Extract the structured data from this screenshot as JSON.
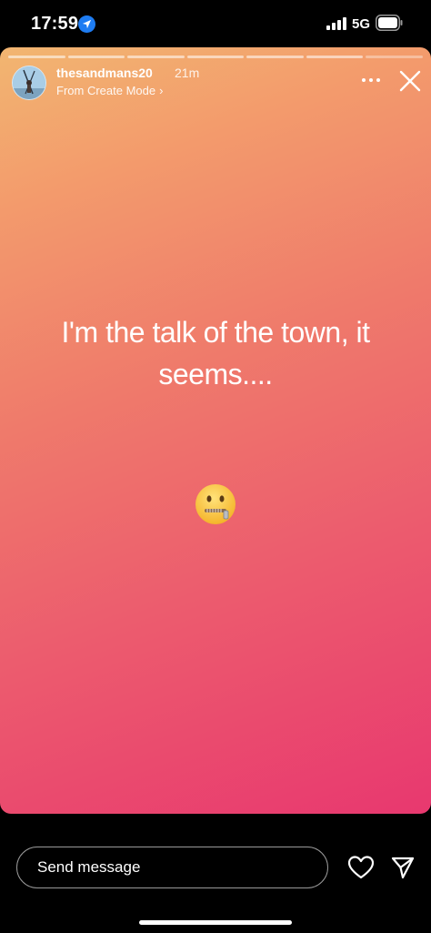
{
  "status_bar": {
    "time": "17:59",
    "network": "5G",
    "location_icon": "location-arrow-icon",
    "signal_icon": "cellular-signal-icon",
    "battery_icon": "battery-icon"
  },
  "story": {
    "segments_total": 7,
    "username": "thesandmans20",
    "age": "21m",
    "subtitle": "From Create Mode",
    "subtitle_icon": "chevron-right-icon",
    "text": "I'm the talk of the town, it seems....",
    "emoji": "zipper-mouth-face",
    "background_colors": [
      "#f2b671",
      "#e8386f"
    ]
  },
  "footer": {
    "message_placeholder": "Send message",
    "like_icon": "heart-icon",
    "share_icon": "send-icon"
  }
}
